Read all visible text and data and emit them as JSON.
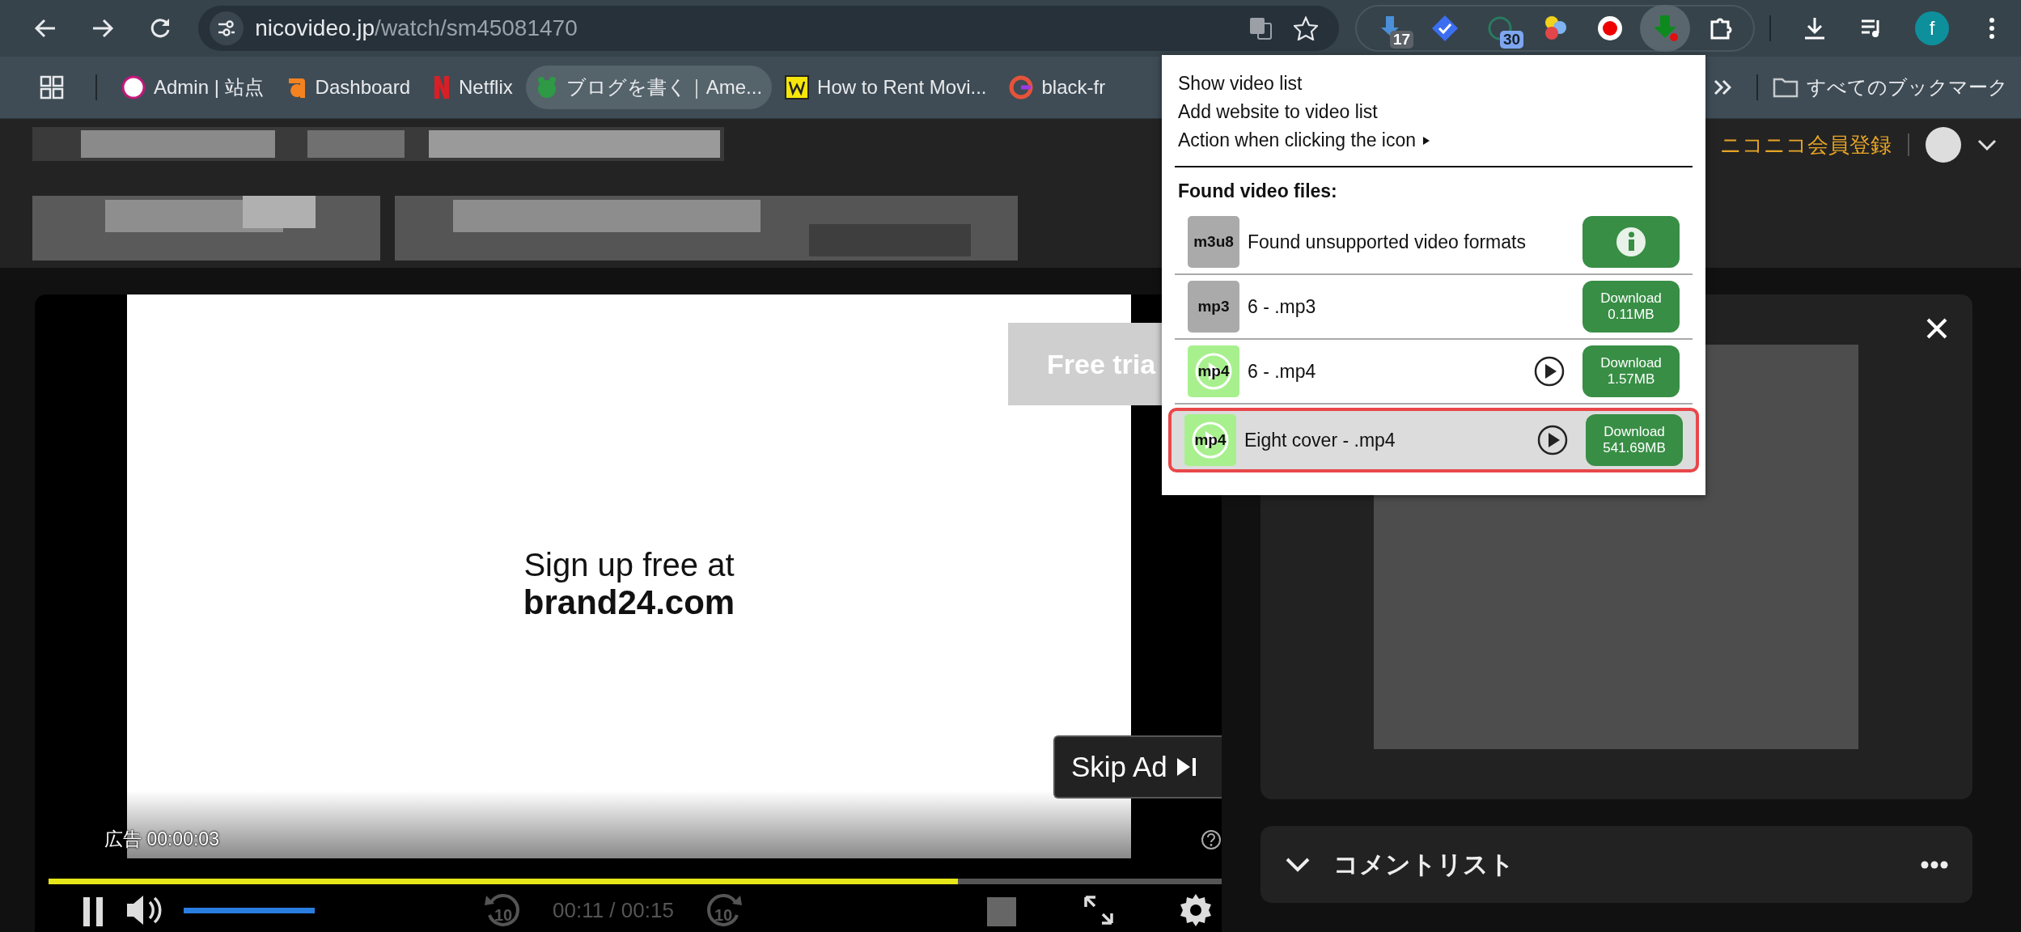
{
  "browser": {
    "url_host": "nicovideo.jp",
    "url_path": "/watch/sm45081470",
    "extensions": [
      {
        "kind": "pin",
        "badge": "17",
        "selected": false
      },
      {
        "kind": "check",
        "selected": false
      },
      {
        "kind": "ring",
        "badge": "30",
        "selected": false
      },
      {
        "kind": "dots",
        "selected": false
      },
      {
        "kind": "record",
        "selected": false
      },
      {
        "kind": "download",
        "selected": true
      },
      {
        "kind": "puzzle",
        "selected": false
      }
    ],
    "profile_initial": "f"
  },
  "bookmarks": [
    {
      "kind": "cms",
      "label": "Admin | 站点",
      "selected": false
    },
    {
      "kind": "a",
      "label": "Dashboard",
      "selected": false
    },
    {
      "kind": "n",
      "label": "Netflix",
      "selected": false
    },
    {
      "kind": "frog",
      "label": "ブログを書く｜Ame...",
      "selected": true
    },
    {
      "kind": "w",
      "label": "How to Rent Movi...",
      "selected": false
    },
    {
      "kind": "g",
      "label": "black-fr",
      "selected": false
    }
  ],
  "all_bookmarks": "すべてのブックマーク",
  "site_header": {
    "register": "ニコニコ会員登録"
  },
  "player": {
    "ad_line1": "Sign up free at",
    "ad_line2": "brand24.com",
    "trial_button": "Free tria",
    "skip": "Skip Ad",
    "ad_timer": "広告 00:00:03",
    "progress": {
      "level": 0.775
    },
    "volume": {
      "level": 1
    },
    "rewind_label": "10",
    "forward_label": "10",
    "time": "00:11 / 00:15"
  },
  "comments": {
    "title": "コメントリスト"
  },
  "popup": {
    "menu": [
      {
        "label": "Show video list",
        "submenu": false
      },
      {
        "label": "Add website to video list",
        "submenu": false
      },
      {
        "label": "Action when clicking the icon",
        "submenu": true
      }
    ],
    "section_title": "Found video files:",
    "files": [
      {
        "kind": "unsupported",
        "format": "m3u8",
        "name": "Found unsupported video formats",
        "selected": false
      },
      {
        "kind": "audio",
        "format": "mp3",
        "name": "6 - .mp3",
        "button": "Download",
        "size": "0.11MB",
        "selected": false
      },
      {
        "kind": "video",
        "format": "mp4",
        "name": "6 - .mp4",
        "button": "Download",
        "size": "1.57MB",
        "selected": false
      },
      {
        "kind": "video",
        "format": "mp4",
        "name": "Eight cover - .mp4",
        "button": "Download",
        "size": "541.69MB",
        "selected": true
      }
    ]
  }
}
